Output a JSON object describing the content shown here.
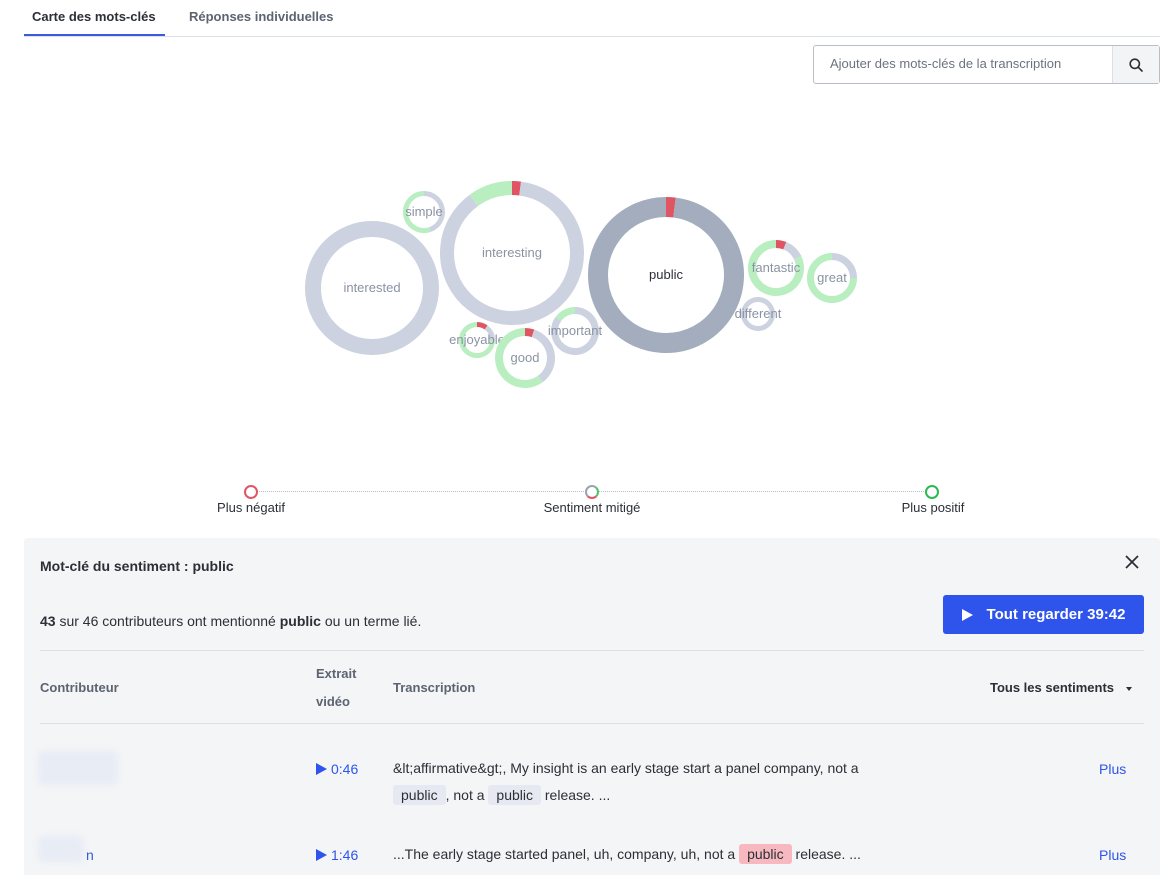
{
  "tabs": [
    {
      "label": "Carte des mots-clés",
      "active": true
    },
    {
      "label": "Réponses individuelles",
      "active": false
    }
  ],
  "search": {
    "placeholder": "Ajouter des mots-clés de la transcription",
    "icon": "search-icon"
  },
  "colors": {
    "positive": "#b8eec0",
    "negative": "#e05564",
    "mixed": "#cdd2e0",
    "selected": "#a3adbd",
    "accent": "#2f54eb"
  },
  "keywords": [
    {
      "word": "interested",
      "positive": 0,
      "negative": 0,
      "mixed": 1.0,
      "selected": false
    },
    {
      "word": "simple",
      "positive": 0.55,
      "negative": 0,
      "mixed": 0.45,
      "selected": false
    },
    {
      "word": "interesting",
      "positive": 0.1,
      "negative": 0.02,
      "mixed": 0.88,
      "selected": false
    },
    {
      "word": "public",
      "positive": 0,
      "negative": 0.02,
      "mixed": 0.98,
      "selected": true
    },
    {
      "word": "fantastic",
      "positive": 0.82,
      "negative": 0.06,
      "mixed": 0.12,
      "selected": false
    },
    {
      "word": "great",
      "positive": 0.75,
      "negative": 0,
      "mixed": 0.25,
      "selected": false
    },
    {
      "word": "different",
      "positive": 0,
      "negative": 0,
      "mixed": 1.0,
      "selected": false
    },
    {
      "word": "enjoyable",
      "positive": 0.75,
      "negative": 0.1,
      "mixed": 0.15,
      "selected": false
    },
    {
      "word": "important",
      "positive": 0.15,
      "negative": 0,
      "mixed": 0.85,
      "selected": false
    },
    {
      "word": "good",
      "positive": 0.6,
      "negative": 0.05,
      "mixed": 0.35,
      "selected": false
    }
  ],
  "legend": {
    "negative": "Plus négatif",
    "mixed": "Sentiment mitigé",
    "positive": "Plus positif"
  },
  "panel": {
    "title": "Mot-clé du sentiment : public",
    "summary": {
      "count": "43",
      "text1": " sur 46 contributeurs ont mentionné ",
      "keyword": "public",
      "text2": " ou un terme lié."
    },
    "watch_all": "Tout regarder 39:42",
    "columns": {
      "contributor": "Contributeur",
      "clip_line1": "Extrait",
      "clip_line2": "vidéo",
      "transcript": "Transcription",
      "sentiment_filter": "Tous les sentiments"
    },
    "rows": [
      {
        "contributor_tail": "",
        "clip": "0:46",
        "t1": "&lt;affirmative&gt;, My insight is an early stage start a panel company, not a",
        "k1": "public",
        "t2": ", not a",
        "k2": "public",
        "t3": " release. ...",
        "more": "Plus"
      },
      {
        "contributor_tail": "n",
        "clip": "1:46",
        "t1": "...The early stage started panel, uh, company, uh, not a",
        "k1": "public",
        "t2": " release. ...",
        "more": "Plus"
      }
    ]
  }
}
